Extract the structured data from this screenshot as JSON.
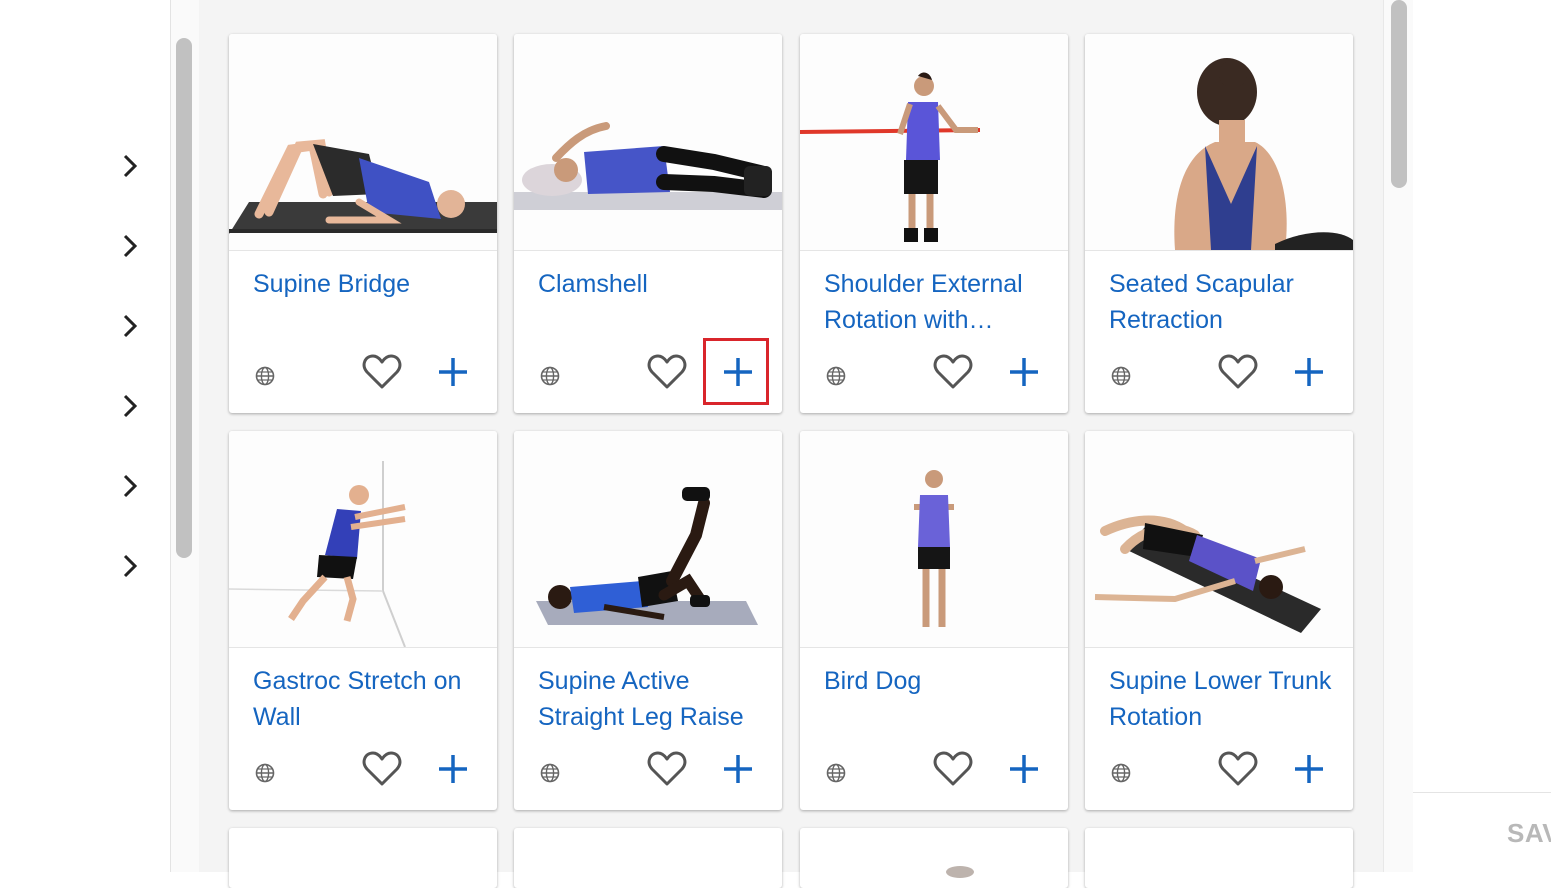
{
  "sidebar": {
    "chevrons": [
      {
        "icon": "chevron-right-icon"
      },
      {
        "icon": "chevron-right-icon"
      },
      {
        "icon": "chevron-right-icon"
      },
      {
        "icon": "chevron-right-icon"
      },
      {
        "icon": "chevron-right-icon"
      },
      {
        "icon": "chevron-right-icon"
      }
    ]
  },
  "exercises": [
    {
      "title": "Supine Bridge"
    },
    {
      "title": "Clamshell"
    },
    {
      "title": "Shoulder External Rotation with…"
    },
    {
      "title": "Seated Scapular Retraction"
    },
    {
      "title": "Gastroc Stretch on Wall"
    },
    {
      "title": "Supine Active Straight Leg Raise"
    },
    {
      "title": "Bird Dog"
    },
    {
      "title": "Supine Lower Trunk Rotation"
    }
  ],
  "card_icons": {
    "globe": "globe-icon",
    "favorite": "heart-outline-icon",
    "add": "plus-icon"
  },
  "footer": {
    "save_label": "SAVE"
  },
  "colors": {
    "accent": "#1565c0",
    "highlight": "#d9252b",
    "icon_gray": "#666666"
  }
}
